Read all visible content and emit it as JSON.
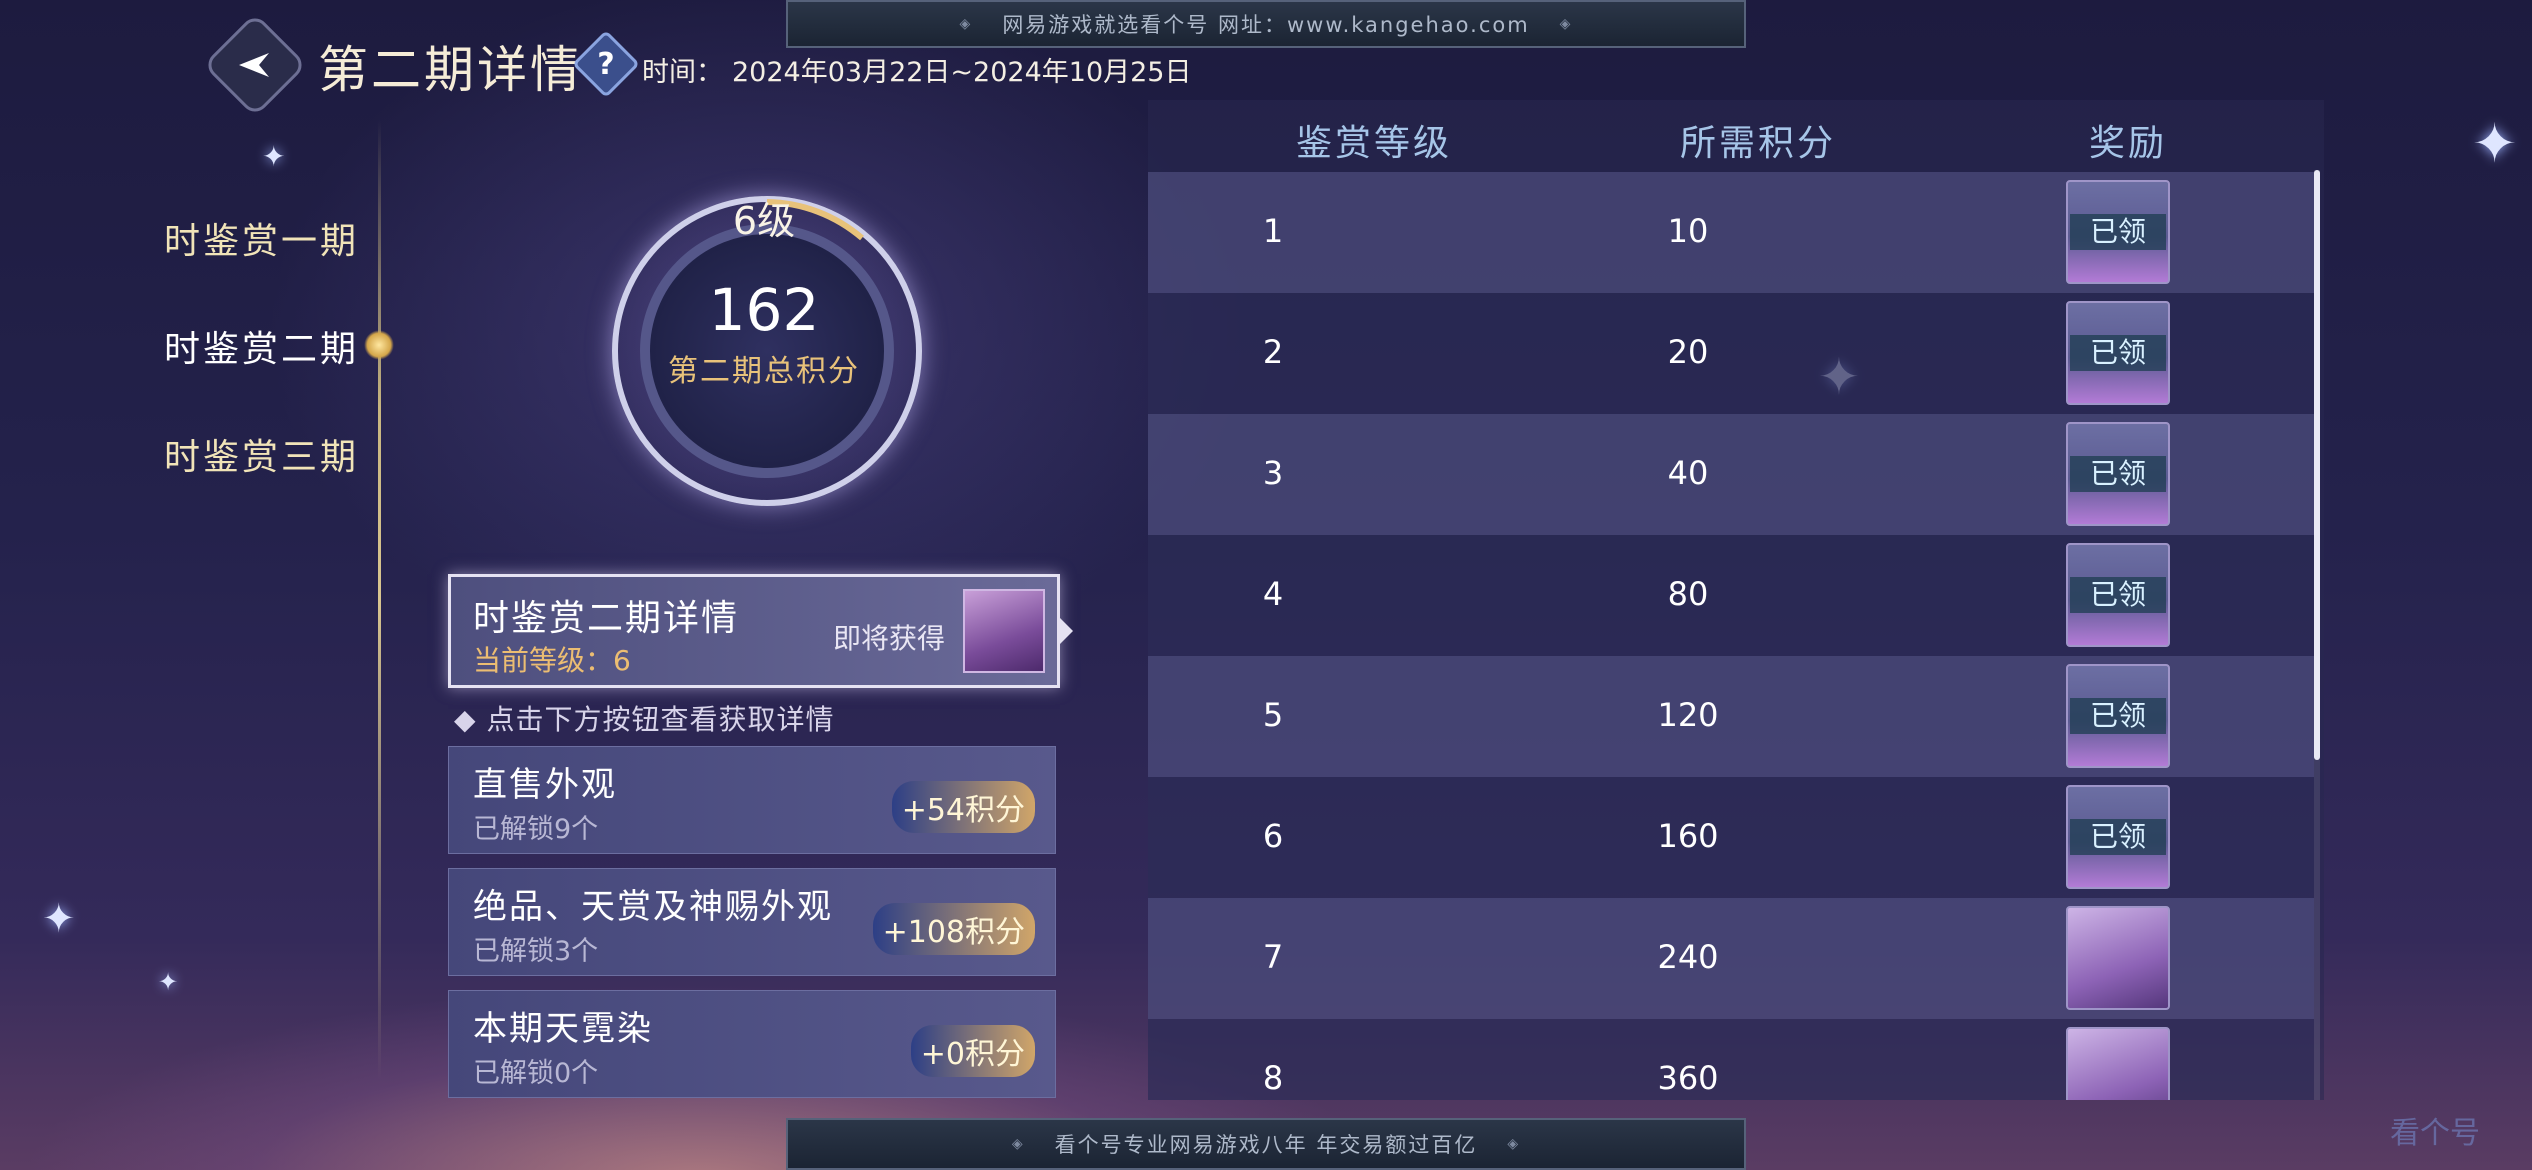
{
  "banners": {
    "top": "网易游戏就选看个号  网址：www.kangehao.com",
    "bottom": "看个号专业网易游戏八年  年交易额过百亿"
  },
  "header": {
    "title": "第二期详情",
    "help": "?",
    "time_label": "时间：",
    "time_value": "2024年03月22日~2024年10月25日"
  },
  "nav": {
    "items": [
      {
        "label": "时鉴赏一期"
      },
      {
        "label": "时鉴赏二期"
      },
      {
        "label": "时鉴赏三期"
      }
    ],
    "active_index": 1
  },
  "score": {
    "level": "6级",
    "value": "162",
    "caption": "第二期总积分"
  },
  "detail": {
    "title": "时鉴赏二期详情",
    "level": "当前等级：6",
    "soon": "即将获得"
  },
  "hint": "点击下方按钮查看获取详情",
  "sources": [
    {
      "title": "直售外观",
      "sub": "已解锁9个",
      "points": "+54积分"
    },
    {
      "title": "绝品、天赏及神赐外观",
      "sub": "已解锁3个",
      "points": "+108积分"
    },
    {
      "title": "本期天霓染",
      "sub": "已解锁0个",
      "points": "+0积分"
    }
  ],
  "table": {
    "headers": [
      "鉴赏等级",
      "所需积分",
      "奖励"
    ],
    "rows": [
      {
        "level": "1",
        "points": "10",
        "reward": "已领"
      },
      {
        "level": "2",
        "points": "20",
        "reward": "已领"
      },
      {
        "level": "3",
        "points": "40",
        "reward": "已领"
      },
      {
        "level": "4",
        "points": "80",
        "reward": "已领"
      },
      {
        "level": "5",
        "points": "120",
        "reward": "已领"
      },
      {
        "level": "6",
        "points": "160",
        "reward": "已领"
      },
      {
        "level": "7",
        "points": "240",
        "reward": ""
      },
      {
        "level": "8",
        "points": "360",
        "reward": ""
      }
    ]
  },
  "watermark": "看个号",
  "colors": {
    "accent_gold": "#ecbd72",
    "header_blue": "#a6c5e8",
    "background": "#24224c"
  }
}
